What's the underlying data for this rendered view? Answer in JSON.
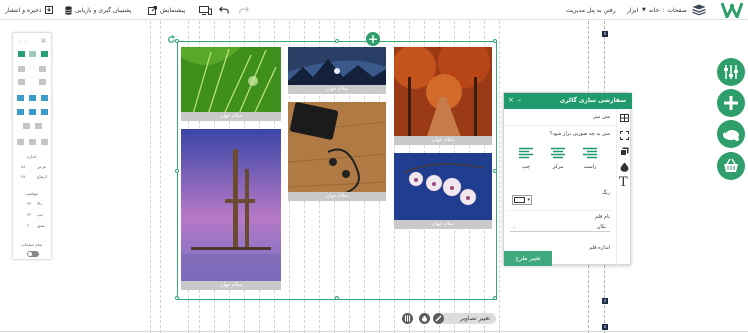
{
  "toolbar": {
    "save_publish": "ذخیره و انتشار",
    "backup_restore": "پشتیبان گیری و بازیابی",
    "preview": "پیشنمایش",
    "go_admin": "رفتن به پنل مدیریت",
    "tools": "ابزار",
    "home": "خانه",
    "pages": "صفحات"
  },
  "gallery": {
    "caption": "سلام جهان"
  },
  "left_panel": {
    "size_label": "اندازه",
    "width_label": "عرض",
    "width_value": "۸۸",
    "height_label": "ارتفاع",
    "height_value": "۲۸",
    "position_label": "موقعیت",
    "top_label": "بالا",
    "top_value": "۴۴",
    "left_label": "چپ",
    "left_value": "۳۲",
    "depth_label": "عمق",
    "depth_value": "۲",
    "fullpage_label": "تمام صفحات"
  },
  "custom_panel": {
    "title": "سفارشی سازی گالری",
    "item_text_label": "متن تیتر",
    "align_question": "متن به چه صورتی تراز شود؟",
    "align_right": "راست",
    "align_center": "مرکز",
    "align_left": "چپ",
    "color_label": "رنگ",
    "font_name_label": "نام قلم",
    "font_name_value": "یکان",
    "font_size_label": "اندازه قلم",
    "apply_button": "تغییر طرح"
  },
  "bottom": {
    "change_images": "تغییر تصاویر"
  },
  "colors": {
    "brand": "#1e9a6c",
    "brand_light": "#3da97c",
    "fab": "#2e9e6b"
  }
}
